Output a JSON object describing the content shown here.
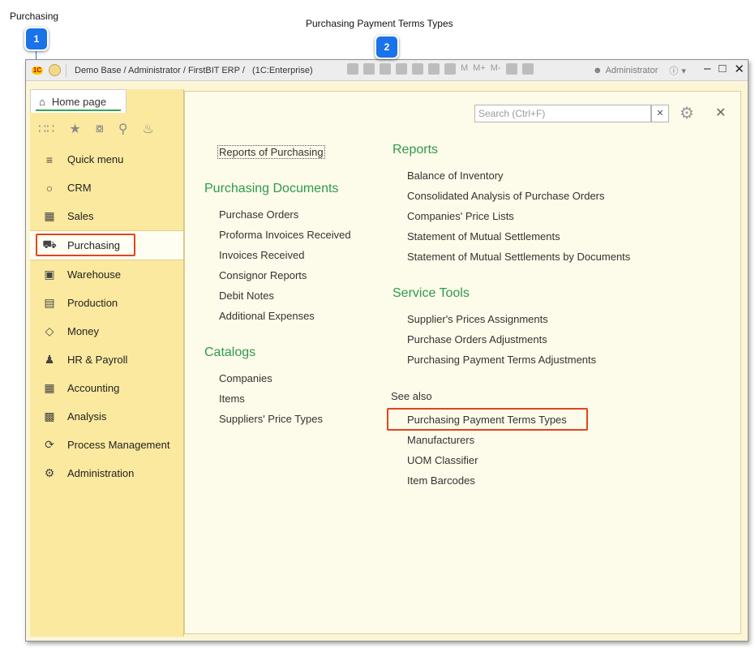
{
  "callouts": [
    {
      "number": "1",
      "label": "Purchasing"
    },
    {
      "number": "2",
      "label": "Purchasing Payment Terms Types"
    }
  ],
  "titlebar": {
    "title": "Demo Base / Administrator / FirstBIT ERP /   (1C:Enterprise)",
    "logo_text": "1C",
    "tool_labels": [
      "M",
      "M+",
      "M-"
    ],
    "user": "Administrator"
  },
  "home_tab": {
    "label": "Home page"
  },
  "sidebar": {
    "items": [
      {
        "label": "Quick menu",
        "icon": "menu-icon"
      },
      {
        "label": "CRM",
        "icon": "chat-icon"
      },
      {
        "label": "Sales",
        "icon": "basket-icon"
      },
      {
        "label": "Purchasing",
        "icon": "truck-icon",
        "active": true
      },
      {
        "label": "Warehouse",
        "icon": "warehouse-icon"
      },
      {
        "label": "Production",
        "icon": "factory-icon"
      },
      {
        "label": "Money",
        "icon": "money-icon"
      },
      {
        "label": "HR & Payroll",
        "icon": "person-icon"
      },
      {
        "label": "Accounting",
        "icon": "calculator-icon"
      },
      {
        "label": "Analysis",
        "icon": "chart-icon"
      },
      {
        "label": "Process Management",
        "icon": "cycle-icon"
      },
      {
        "label": "Administration",
        "icon": "gear-icon"
      }
    ]
  },
  "search": {
    "placeholder": "Search (Ctrl+F)"
  },
  "left_column": {
    "reports_link": "Reports of Purchasing",
    "purchasing_documents": {
      "title": "Purchasing Documents",
      "items": [
        "Purchase Orders",
        "Proforma Invoices Received",
        "Invoices Received",
        "Consignor Reports",
        "Debit Notes",
        "Additional Expenses"
      ]
    },
    "catalogs": {
      "title": "Catalogs",
      "items": [
        "Companies",
        "Items",
        "Suppliers' Price Types"
      ]
    }
  },
  "right_column": {
    "reports": {
      "title": "Reports",
      "items": [
        "Balance of Inventory",
        "Consolidated Analysis of Purchase Orders",
        "Companies' Price Lists",
        "Statement of Mutual Settlements",
        "Statement of Mutual Settlements by Documents"
      ]
    },
    "service_tools": {
      "title": "Service Tools",
      "items": [
        "Supplier's Prices Assignments",
        "Purchase Orders Adjustments",
        "Purchasing Payment Terms Adjustments"
      ]
    },
    "see_also": {
      "title": "See also",
      "items": [
        "Purchasing Payment Terms Types",
        "Manufacturers",
        "UOM Classifier",
        "Item Barcodes"
      ]
    }
  },
  "colors": {
    "accent_green": "#2e9a4e",
    "highlight": "#e1451e",
    "badge": "#1a73e8",
    "sidebar": "#fbe99f"
  }
}
